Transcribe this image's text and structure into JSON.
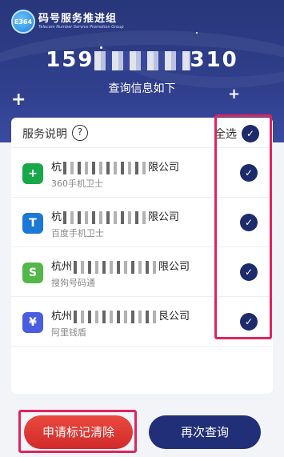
{
  "brand": {
    "logo_text": "E364",
    "title": "码号服务推进组",
    "subtitle": "Telecom Number Service Promotion Group"
  },
  "query": {
    "phone_prefix": "159",
    "phone_suffix": "310",
    "subtitle": "查询信息如下"
  },
  "services": {
    "title": "服务说明",
    "help_symbol": "?",
    "select_all": "全选",
    "items": [
      {
        "company_prefix": "杭",
        "company_suffix": "限公司",
        "app": "360手机卫士",
        "icon": "plus-shield-icon",
        "color": "#17a84a"
      },
      {
        "company_prefix": "杭",
        "company_suffix": "限公司",
        "app": "百度手机卫士",
        "icon": "t-shield-icon",
        "color": "#1b78d6"
      },
      {
        "company_prefix": "杭州",
        "company_suffix": "限公司",
        "app": "搜狗号码通",
        "icon": "phone-s-icon",
        "color": "#53b84a"
      },
      {
        "company_prefix": "杭州",
        "company_suffix": "艮公司",
        "app": "阿里钱盾",
        "icon": "yuan-shield-icon",
        "color": "#4a5de0"
      }
    ]
  },
  "buttons": {
    "clear": "申请标记清除",
    "requery": "再次查询"
  },
  "colors": {
    "header_bg": "#2f3f8c",
    "check": "#1d2b6c",
    "clear_button": "#d12a2a",
    "requery_button": "#202f78",
    "highlight": "#e0245e"
  }
}
